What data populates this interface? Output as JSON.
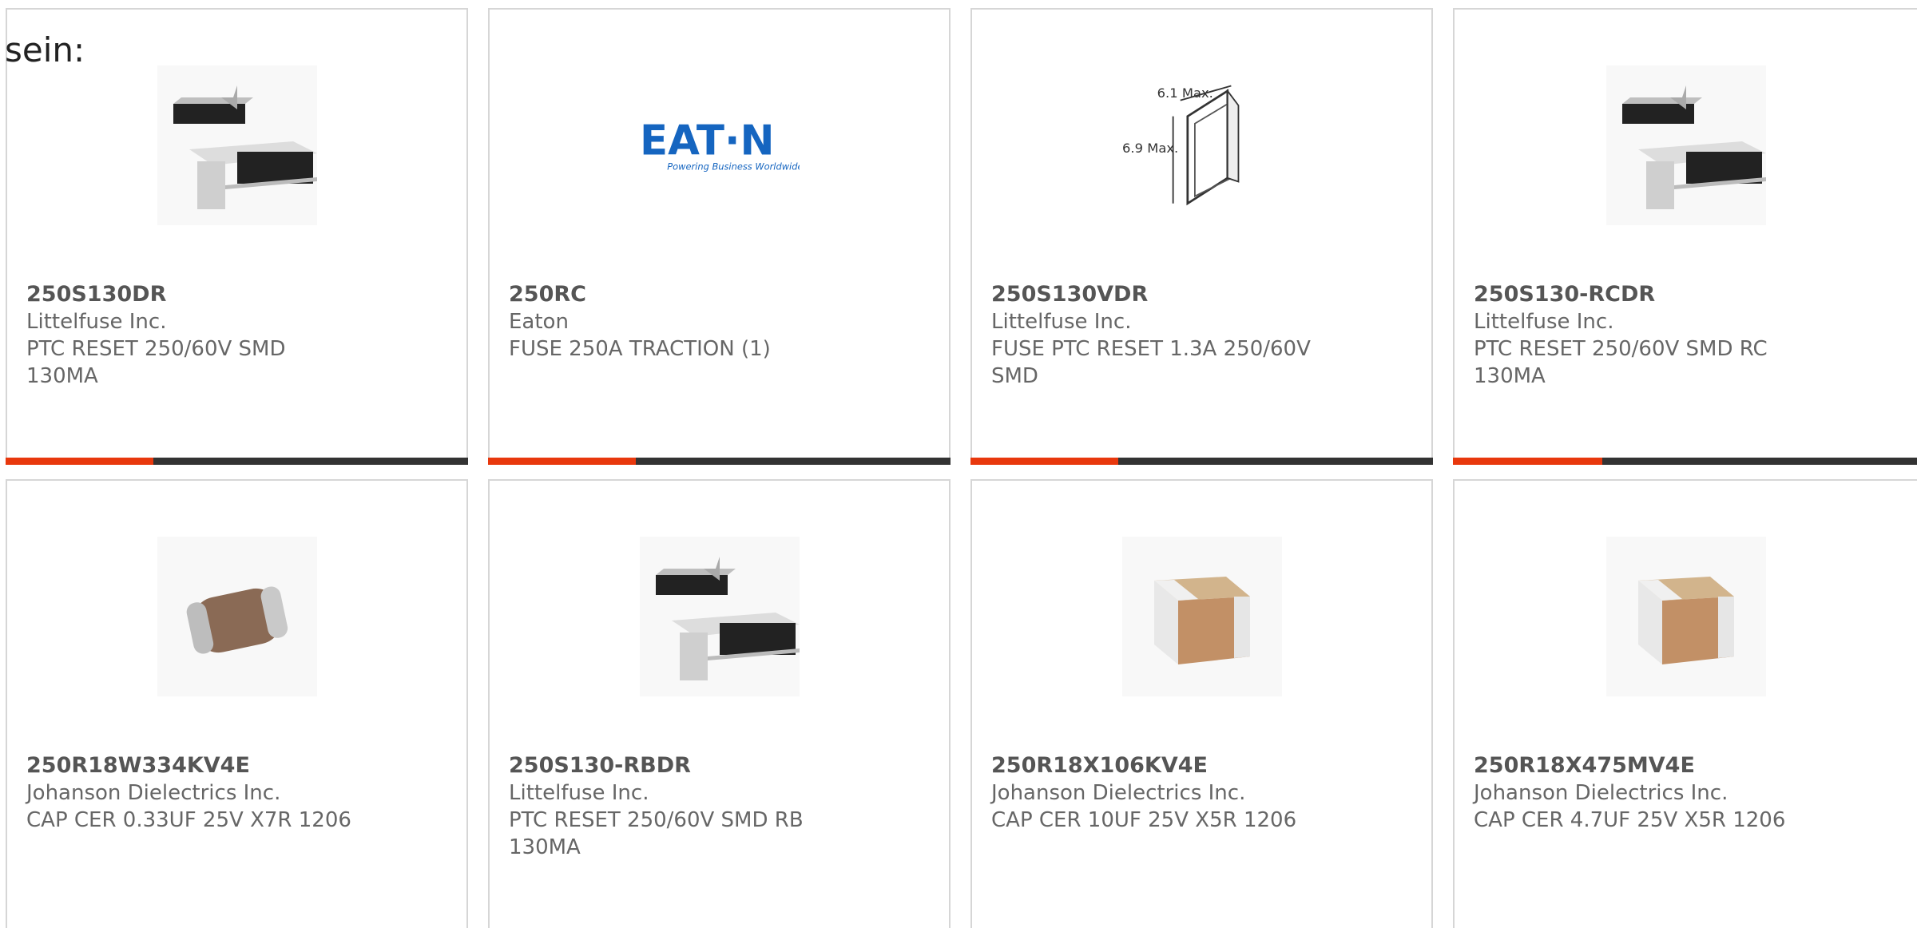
{
  "intro": "sein:",
  "accent_color": "#e8380d",
  "bar_color": "#333333",
  "row1": [
    {
      "part": "250S130DR",
      "maker": "Littelfuse Inc.",
      "desc": "PTC RESET 250/60V SMD 130MA",
      "image": "ptc-smd-image",
      "progress": 0.32
    },
    {
      "part": "250RC",
      "maker": "Eaton",
      "desc": "FUSE 250A TRACTION (1)",
      "image": "eaton-logo",
      "logo_text": "EAT·N",
      "logo_tag": "Powering Business Worldwide",
      "progress": 0.32
    },
    {
      "part": "250S130VDR",
      "maker": "Littelfuse Inc.",
      "desc": "FUSE PTC RESET 1.3A 250/60V SMD",
      "image": "dimension-drawing",
      "dim1": "6.1 Max.",
      "dim2": "6.9 Max.",
      "progress": 0.32
    },
    {
      "part": "250S130-RCDR",
      "maker": "Littelfuse Inc.",
      "desc": "PTC RESET 250/60V SMD RC 130MA",
      "image": "ptc-smd-image",
      "progress": 0.32
    }
  ],
  "row2": [
    {
      "part": "250R18W334KV4E",
      "maker": "Johanson Dielectrics Inc.",
      "desc": "CAP CER 0.33UF 25V X7R 1206",
      "image": "mlcc-rounded-image"
    },
    {
      "part": "250S130-RBDR",
      "maker": "Littelfuse Inc.",
      "desc": "PTC RESET 250/60V SMD RB 130MA",
      "image": "ptc-smd-image"
    },
    {
      "part": "250R18X106KV4E",
      "maker": "Johanson Dielectrics Inc.",
      "desc": "CAP CER 10UF 25V X5R 1206",
      "image": "mlcc-box-image"
    },
    {
      "part": "250R18X475MV4E",
      "maker": "Johanson Dielectrics Inc.",
      "desc": "CAP CER 4.7UF 25V X5R 1206",
      "image": "mlcc-box-image"
    }
  ]
}
